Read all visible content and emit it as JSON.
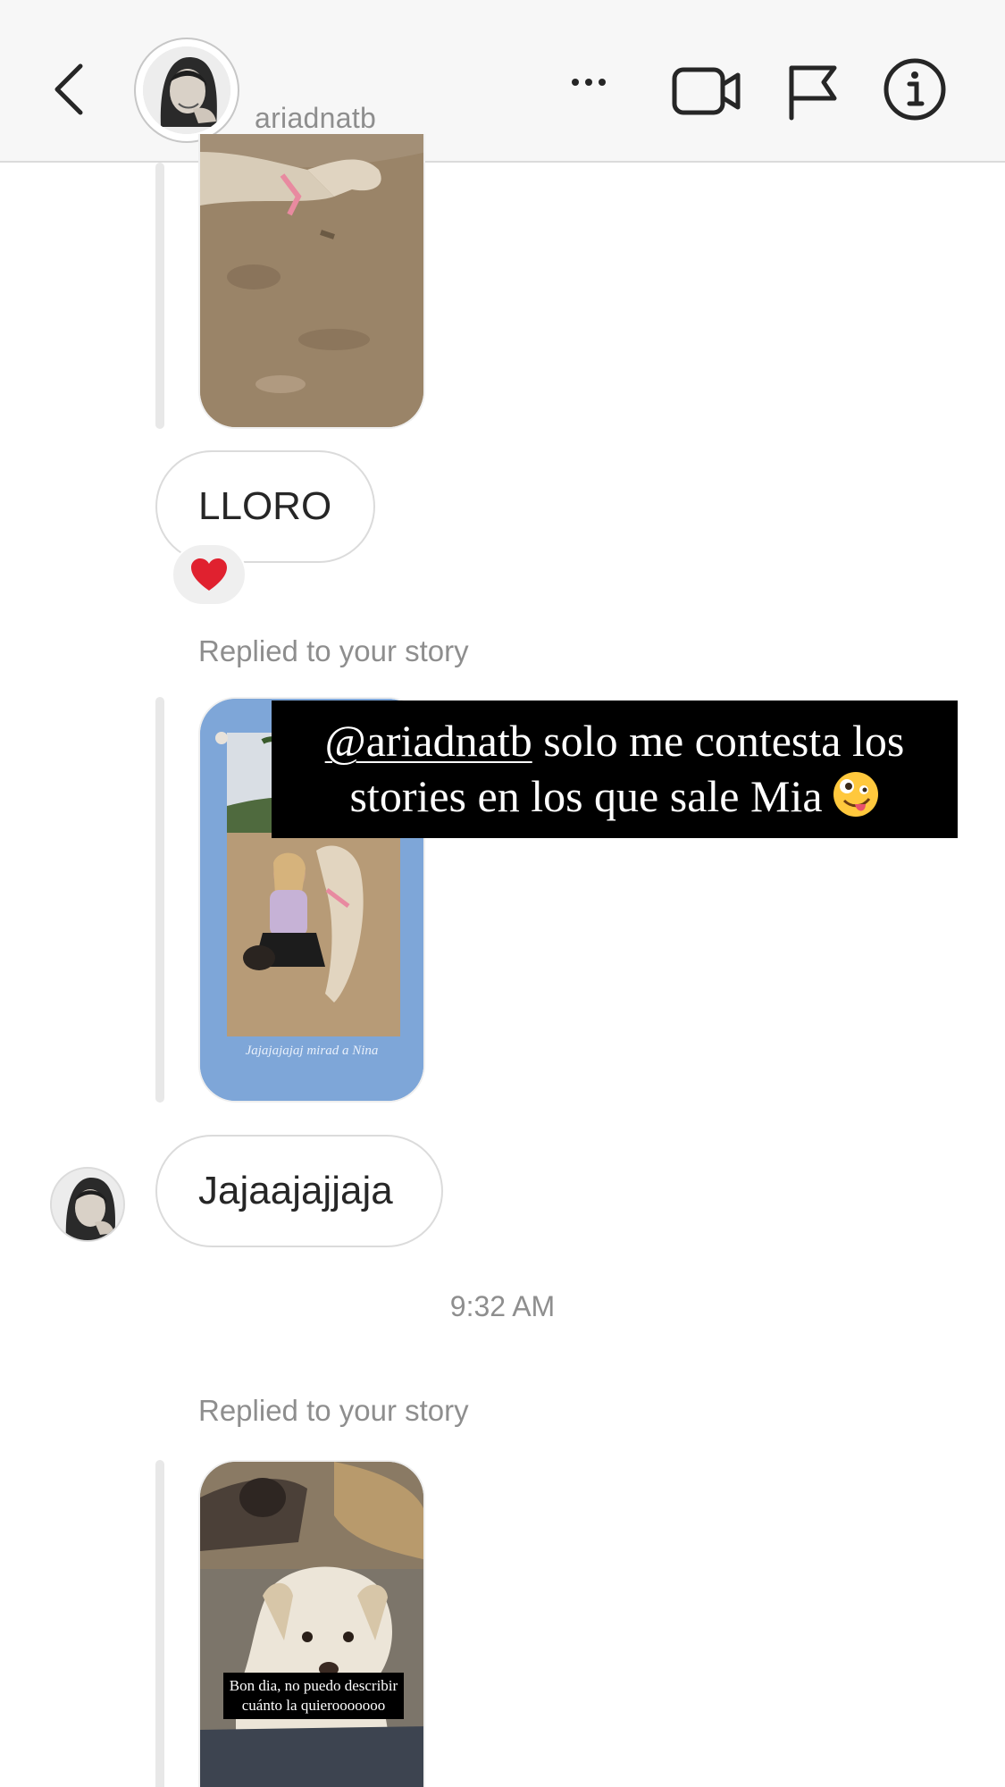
{
  "header": {
    "username": "ariadnatb",
    "icons": [
      "back-chevron-icon",
      "more-icon",
      "video-call-icon",
      "flag-icon",
      "info-icon"
    ]
  },
  "thread": {
    "messages": [
      {
        "type": "text",
        "text": "LLORO",
        "reaction": "heart"
      },
      {
        "type": "meta",
        "text": "Replied to your story"
      },
      {
        "type": "story",
        "caption": "Jajajajajaj mirad a Nina"
      },
      {
        "type": "text",
        "text": "Jajaajajjaja"
      },
      {
        "type": "timestamp",
        "text": "9:32 AM"
      },
      {
        "type": "meta",
        "text": "Replied to your story"
      },
      {
        "type": "story",
        "caption": "Bon dia, no puedo describir cuánto la quierooooooo"
      }
    ]
  },
  "overlay": {
    "mention": "@ariadnatb",
    "line1_rest": " solo me contesta los",
    "line2": "stories en los que sale Mia"
  },
  "colors": {
    "header_bg": "#f7f7f7",
    "bubble_border": "#dbdbdb",
    "meta_text": "#8e8e8e",
    "story_blue": "#7ea6d8",
    "reaction_heart": "#e0212f"
  }
}
